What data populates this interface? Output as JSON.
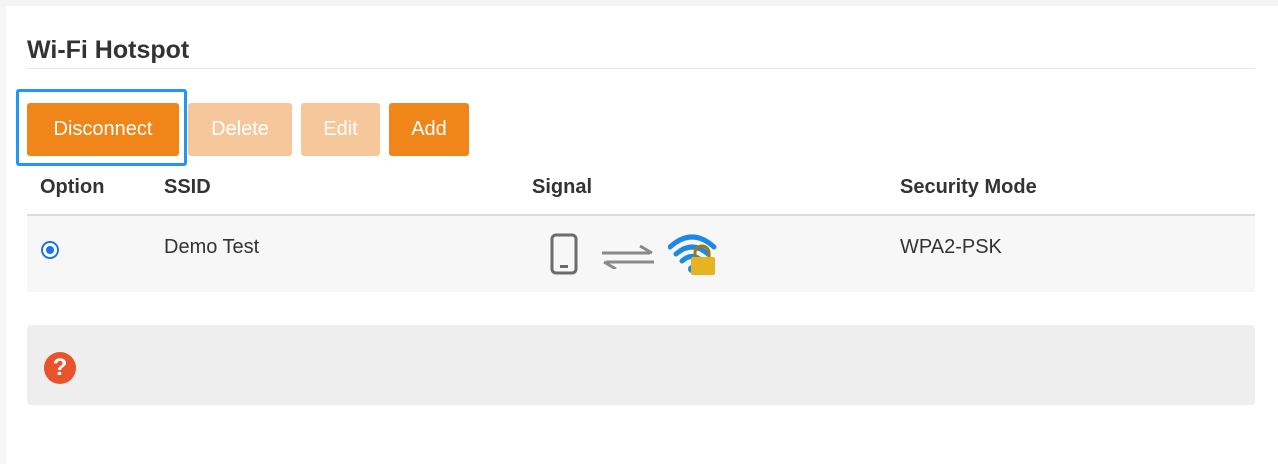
{
  "page": {
    "title": "Wi-Fi Hotspot"
  },
  "toolbar": {
    "disconnect_label": "Disconnect",
    "delete_label": "Delete",
    "edit_label": "Edit",
    "add_label": "Add"
  },
  "table": {
    "columns": [
      "Option",
      "SSID",
      "Signal",
      "Security Mode"
    ],
    "rows": [
      {
        "selected": true,
        "ssid": "Demo Test",
        "signal_icons": [
          "phone-icon",
          "transfer-arrows-icon",
          "wifi-lock-icon"
        ],
        "security_mode": "WPA2-PSK"
      }
    ]
  },
  "help": {
    "icon": "question-icon",
    "symbol": "?"
  },
  "colors": {
    "accent": "#f08519",
    "accent_disabled": "#f6c79b",
    "focus": "#2196f3",
    "radio": "#1a73e8",
    "help_icon": "#e8532c",
    "wifi": "#1e88e5",
    "lock": "#e8b320"
  }
}
